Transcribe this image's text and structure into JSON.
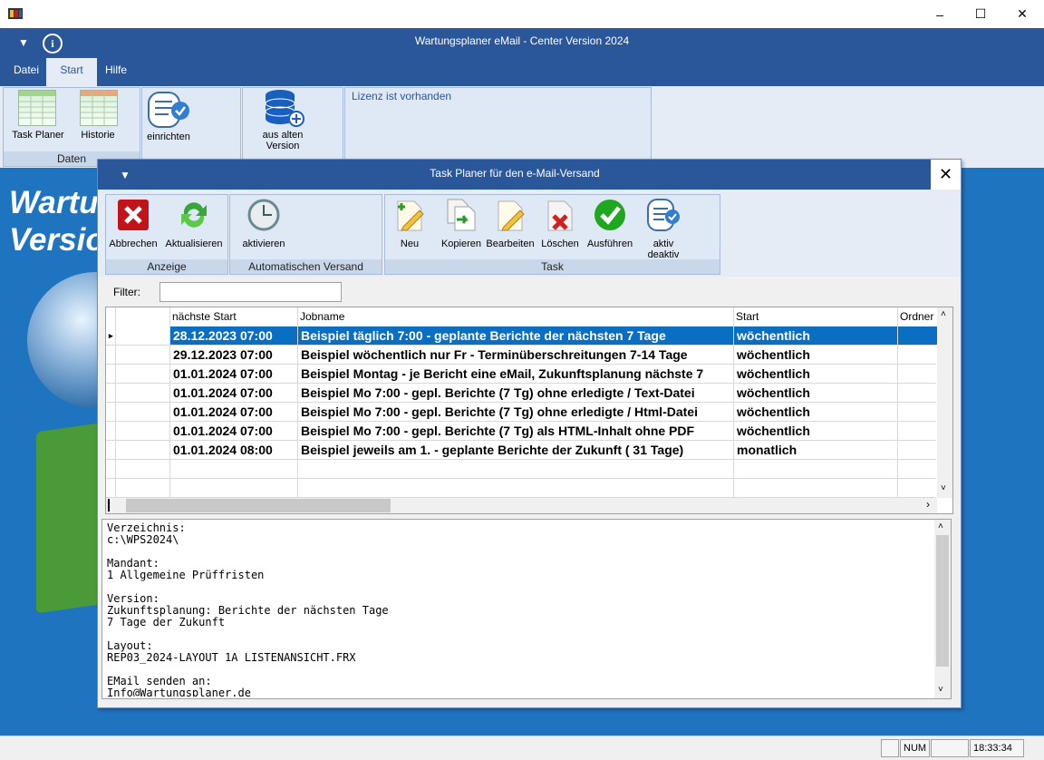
{
  "app": {
    "title": "Wartungsplaner eMail - Center Version 2024",
    "menu": [
      "Datei",
      "Start",
      "Hilfe"
    ],
    "ribbon": {
      "task_planer": "Task Planer",
      "historie": "Historie",
      "einrichten": "einrichten",
      "aus_alten_1": "aus alten",
      "aus_alten_2": "Version",
      "group_daten": "Daten",
      "lizenz": "Lizenz ist vorhanden"
    },
    "bg_text_1": "Wartu",
    "bg_text_2": "Versio"
  },
  "dialog": {
    "title": "Task Planer für den e-Mail-Versand",
    "buttons": {
      "abbrechen": "Abbrechen",
      "aktualisieren": "Aktualisieren",
      "aktivieren": "aktivieren",
      "neu": "Neu",
      "kopieren": "Kopieren",
      "bearbeiten": "Bearbeiten",
      "loeschen": "Löschen",
      "ausfuehren": "Ausführen",
      "aktiv": "aktiv",
      "deaktiv": "deaktiv"
    },
    "groups": {
      "anzeige": "Anzeige",
      "auto": "Automatischen Versand",
      "task": "Task"
    },
    "filter_label": "Filter:",
    "filter_value": "",
    "grid": {
      "headers": [
        "nächste Start",
        "Jobname",
        "Start",
        "Ordner"
      ],
      "rows": [
        [
          "28.12.2023 07:00",
          "Beispiel täglich 7:00 - geplante Berichte der nächsten 7 Tage",
          "wöchentlich",
          ""
        ],
        [
          "29.12.2023 07:00",
          "Beispiel wöchentlich nur Fr - Terminüberschreitungen 7-14 Tage",
          "wöchentlich",
          ""
        ],
        [
          "01.01.2024 07:00",
          "Beispiel Montag - je Bericht eine eMail, Zukunftsplanung nächste 7",
          "wöchentlich",
          ""
        ],
        [
          "01.01.2024 07:00",
          "Beispiel Mo 7:00 - gepl. Berichte (7 Tg)  ohne erledigte / Text-Datei",
          "wöchentlich",
          ""
        ],
        [
          "01.01.2024 07:00",
          "Beispiel Mo 7:00 - gepl. Berichte (7 Tg)  ohne erledigte / Html-Datei",
          "wöchentlich",
          ""
        ],
        [
          "01.01.2024 07:00",
          "Beispiel Mo 7:00 - gepl. Berichte (7 Tg)  als HTML-Inhalt ohne PDF",
          "wöchentlich",
          ""
        ],
        [
          "01.01.2024 08:00",
          "Beispiel jeweils am 1. - geplante Berichte der Zukunft ( 31 Tage)",
          "monatlich",
          ""
        ]
      ]
    },
    "memo": "Verzeichnis:\nc:\\WPS2024\\\n\nMandant:\n1 Allgemeine Prüffristen\n\nVersion:\nZukunftsplanung: Berichte der nächsten Tage\n7 Tage der Zukunft\n\nLayout:\nREP03_2024-LAYOUT 1A LISTENANSICHT.FRX\n\nEMail senden an:\nInfo@Wartungsplaner.de"
  },
  "status": {
    "num": "NUM",
    "time": "18:33:34"
  }
}
